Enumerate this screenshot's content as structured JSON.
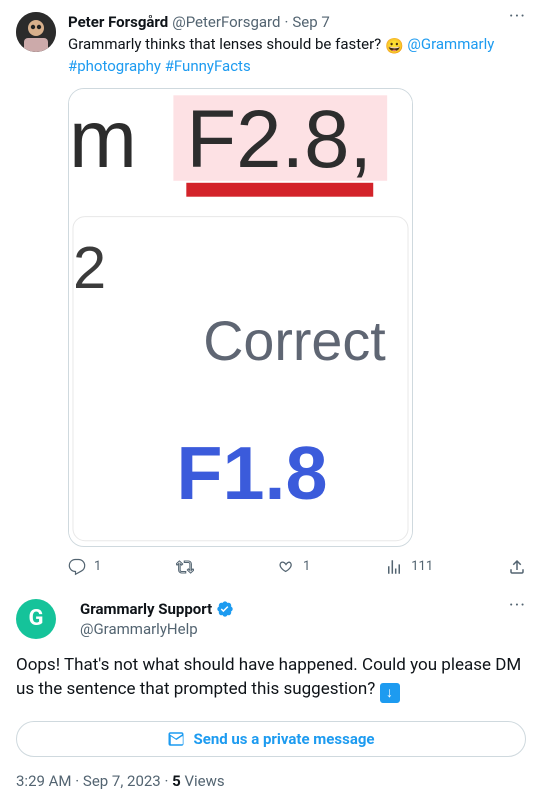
{
  "quoted": {
    "name": "Peter Forsgård",
    "handle": "@PeterForsgard",
    "date": "Sep 7",
    "text_pre": "Grammarly thinks that lenses should be faster? ",
    "mention": "@Grammarly",
    "hashtag1": "#photography",
    "hashtag2": "#FunnyFacts",
    "media": {
      "top_left": "m",
      "top_f": "F2.8,",
      "left_digit": "2",
      "correct_label": "Correct",
      "suggestion": "F1.8"
    },
    "actions": {
      "reply_count": "1",
      "retweet_count": "",
      "like_count": "1",
      "view_count": "111"
    }
  },
  "reply": {
    "name": "Grammarly Support",
    "handle": "@GrammarlyHelp",
    "body": "Oops! That's not what should have happened. Could you please DM us the sentence that prompted this suggestion? ",
    "dm_button": "Send us a private message",
    "time": "3:29 AM",
    "date": "Sep 7, 2023",
    "views_count": "5",
    "views_label": "Views"
  }
}
